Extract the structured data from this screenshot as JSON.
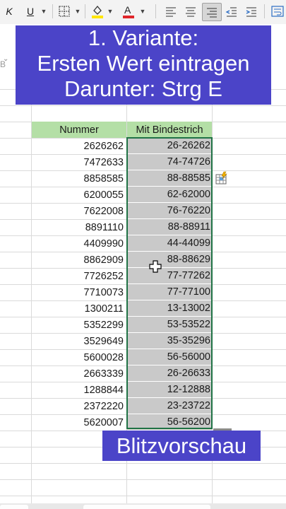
{
  "toolbar": {
    "italic_label": "K",
    "underline_label": "U"
  },
  "banner": {
    "line1": "1. Variante:",
    "line2": "Ersten Wert eintragen",
    "line3": "Darunter: Strg E"
  },
  "left_edge": {
    "fragment": "B"
  },
  "table": {
    "headers": [
      "Nummer",
      "Mit Bindestrich"
    ],
    "header_color": "#b4dfa6",
    "rows": [
      [
        "2626262",
        "26-26262"
      ],
      [
        "7472633",
        "74-74726"
      ],
      [
        "8858585",
        "88-88585"
      ],
      [
        "6200055",
        "62-62000"
      ],
      [
        "7622008",
        "76-76220"
      ],
      [
        "8891110",
        "88-88911"
      ],
      [
        "4409990",
        "44-44099"
      ],
      [
        "8862909",
        "88-88629"
      ],
      [
        "7726252",
        "77-77262"
      ],
      [
        "7710073",
        "77-77100"
      ],
      [
        "1300211",
        "13-13002"
      ],
      [
        "5352299",
        "53-53522"
      ],
      [
        "3529649",
        "35-35296"
      ],
      [
        "5600028",
        "56-56000"
      ],
      [
        "2663339",
        "26-26633"
      ],
      [
        "1288844",
        "12-12888"
      ],
      [
        "2372220",
        "23-23722"
      ],
      [
        "5620007",
        "56-56200"
      ]
    ]
  },
  "caption": "Blitzvorschau",
  "colors": {
    "banner_bg": "#4b44c8",
    "selection_border": "#217346",
    "preview_fill": "#c9c9c9",
    "font_color_bar": "#e0262b",
    "fill_color_bar": "#ffe600"
  }
}
